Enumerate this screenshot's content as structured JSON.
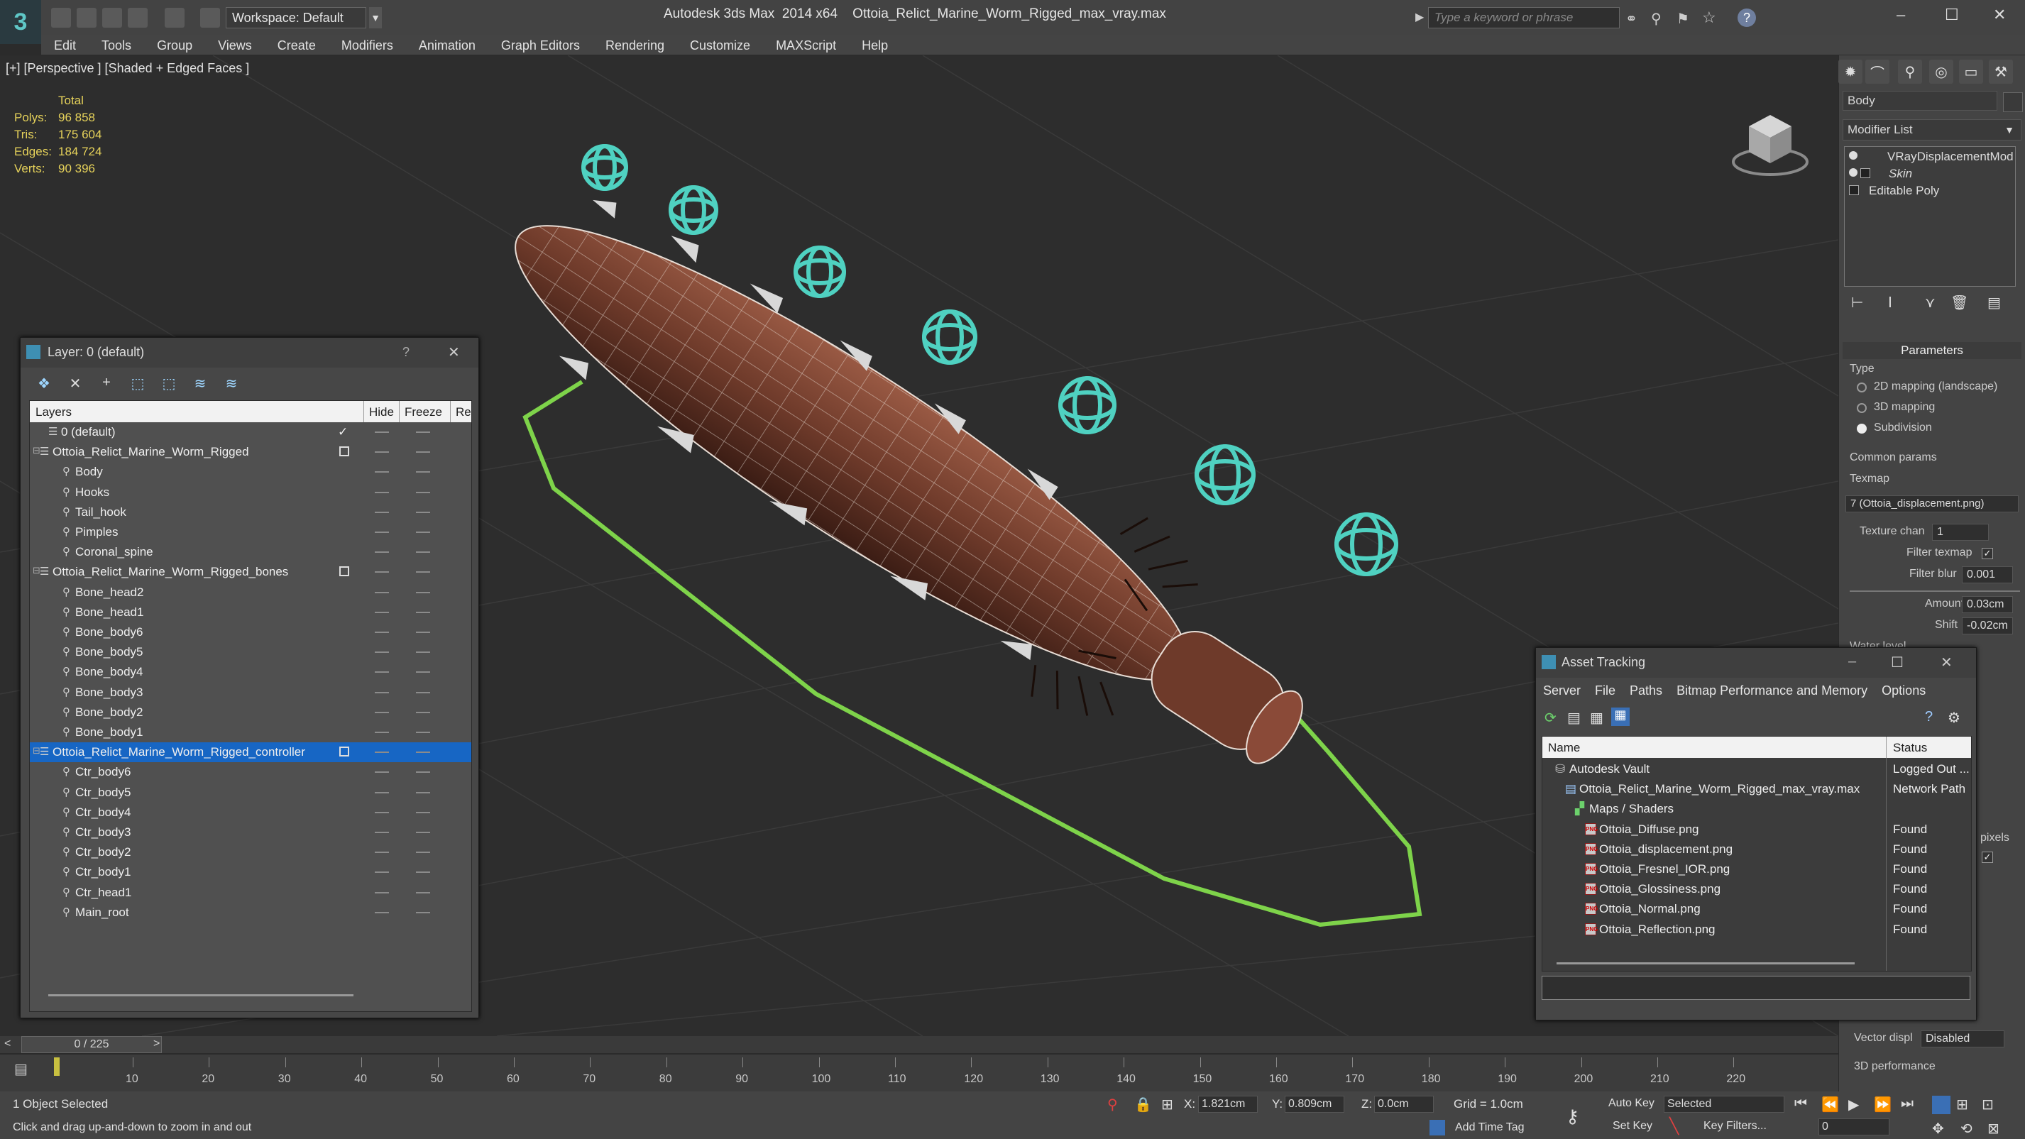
{
  "app": {
    "title": "Autodesk 3ds Max  2014 x64",
    "file": "Ottoia_Relict_Marine_Worm_Rigged_max_vray.max",
    "workspace": "Workspace: Default",
    "search_placeholder": "Type a keyword or phrase"
  },
  "menu": [
    "Edit",
    "Tools",
    "Group",
    "Views",
    "Create",
    "Modifiers",
    "Animation",
    "Graph Editors",
    "Rendering",
    "Customize",
    "MAXScript",
    "Help"
  ],
  "viewport": {
    "label": "[+] [Perspective ] [Shaded + Edged Faces ]",
    "stats_header": "Total",
    "stats": [
      {
        "key": "Polys:",
        "value": "96 858"
      },
      {
        "key": "Tris:",
        "value": "175 604"
      },
      {
        "key": "Edges:",
        "value": "184 724"
      },
      {
        "key": "Verts:",
        "value": "90 396"
      }
    ]
  },
  "command_panel": {
    "object_name": "Body",
    "modifier_list": "Modifier List",
    "stack": [
      "VRayDisplacementMod",
      "Skin",
      "Editable Poly"
    ],
    "params_title": "Parameters",
    "type_label": "Type",
    "type_options": [
      {
        "label": "2D mapping (landscape)",
        "selected": false
      },
      {
        "label": "3D mapping",
        "selected": false
      },
      {
        "label": "Subdivision",
        "selected": true
      }
    ],
    "common_params": "Common params",
    "texmap_label": "Texmap",
    "texmap_value": "7 (Ottoia_displacement.png)",
    "texture_chan_label": "Texture chan",
    "texture_chan_value": "1",
    "filter_texmap_label": "Filter texmap",
    "filter_blur_label": "Filter blur",
    "filter_blur_value": "0.001",
    "amount_label": "Amount",
    "amount_value": "0.03cm",
    "shift_label": "Shift",
    "shift_value": "-0.02cm",
    "water_level_label": "Water level",
    "pixels_label": "pixels",
    "vector_disp_label": "Vector displ",
    "vector_disp_value": "Disabled",
    "perf_label": "3D performance"
  },
  "layer_dialog": {
    "title": "Layer: 0 (default)",
    "help": "?",
    "columns": {
      "layers": "Layers",
      "hide": "Hide",
      "freeze": "Freeze",
      "render": "Re"
    },
    "rows": [
      {
        "name": "0 (default)",
        "indent": 1,
        "type": "layer",
        "current": true
      },
      {
        "name": "Ottoia_Relict_Marine_Worm_Rigged",
        "indent": 0,
        "type": "layer",
        "box": true
      },
      {
        "name": "Body",
        "indent": 2,
        "type": "object"
      },
      {
        "name": "Hooks",
        "indent": 2,
        "type": "object"
      },
      {
        "name": "Tail_hook",
        "indent": 2,
        "type": "object"
      },
      {
        "name": "Pimples",
        "indent": 2,
        "type": "object"
      },
      {
        "name": "Coronal_spine",
        "indent": 2,
        "type": "object"
      },
      {
        "name": "Ottoia_Relict_Marine_Worm_Rigged_bones",
        "indent": 0,
        "type": "layer",
        "box": true
      },
      {
        "name": "Bone_head2",
        "indent": 2,
        "type": "object"
      },
      {
        "name": "Bone_head1",
        "indent": 2,
        "type": "object"
      },
      {
        "name": "Bone_body6",
        "indent": 2,
        "type": "object"
      },
      {
        "name": "Bone_body5",
        "indent": 2,
        "type": "object"
      },
      {
        "name": "Bone_body4",
        "indent": 2,
        "type": "object"
      },
      {
        "name": "Bone_body3",
        "indent": 2,
        "type": "object"
      },
      {
        "name": "Bone_body2",
        "indent": 2,
        "type": "object"
      },
      {
        "name": "Bone_body1",
        "indent": 2,
        "type": "object"
      },
      {
        "name": "Ottoia_Relict_Marine_Worm_Rigged_controller",
        "indent": 0,
        "type": "layer",
        "box": true,
        "selected": true
      },
      {
        "name": "Ctr_body6",
        "indent": 2,
        "type": "object"
      },
      {
        "name": "Ctr_body5",
        "indent": 2,
        "type": "object"
      },
      {
        "name": "Ctr_body4",
        "indent": 2,
        "type": "object"
      },
      {
        "name": "Ctr_body3",
        "indent": 2,
        "type": "object"
      },
      {
        "name": "Ctr_body2",
        "indent": 2,
        "type": "object"
      },
      {
        "name": "Ctr_body1",
        "indent": 2,
        "type": "object"
      },
      {
        "name": "Ctr_head1",
        "indent": 2,
        "type": "object"
      },
      {
        "name": "Main_root",
        "indent": 2,
        "type": "object"
      }
    ]
  },
  "asset_dialog": {
    "title": "Asset Tracking",
    "menu": [
      "Server",
      "File",
      "Paths",
      "Bitmap Performance and Memory",
      "Options"
    ],
    "columns": {
      "name": "Name",
      "status": "Status"
    },
    "rows": [
      {
        "name": "Autodesk Vault",
        "indent": 1,
        "status": "Logged Out ...",
        "icon": "vault"
      },
      {
        "name": "Ottoia_Relict_Marine_Worm_Rigged_max_vray.max",
        "indent": 2,
        "status": "Network Path",
        "icon": "max"
      },
      {
        "name": "Maps / Shaders",
        "indent": 3,
        "status": "",
        "icon": "folder"
      },
      {
        "name": "Ottoia_Diffuse.png",
        "indent": 4,
        "status": "Found",
        "icon": "png"
      },
      {
        "name": "Ottoia_displacement.png",
        "indent": 4,
        "status": "Found",
        "icon": "png"
      },
      {
        "name": "Ottoia_Fresnel_IOR.png",
        "indent": 4,
        "status": "Found",
        "icon": "png"
      },
      {
        "name": "Ottoia_Glossiness.png",
        "indent": 4,
        "status": "Found",
        "icon": "png"
      },
      {
        "name": "Ottoia_Normal.png",
        "indent": 4,
        "status": "Found",
        "icon": "png"
      },
      {
        "name": "Ottoia_Reflection.png",
        "indent": 4,
        "status": "Found",
        "icon": "png"
      }
    ]
  },
  "timeline": {
    "frame": "0 / 225",
    "ticks": [
      "10",
      "20",
      "30",
      "40",
      "50",
      "60",
      "70",
      "80",
      "90",
      "100",
      "110",
      "120",
      "130",
      "140",
      "150",
      "160",
      "170",
      "180",
      "190",
      "200",
      "210",
      "220"
    ]
  },
  "status": {
    "selection": "1 Object Selected",
    "prompt": "Click and drag up-and-down to zoom in and out",
    "x_label": "X:",
    "x_value": "1.821cm",
    "y_label": "Y:",
    "y_value": "0.809cm",
    "z_label": "Z:",
    "z_value": "0.0cm",
    "grid": "Grid = 1.0cm",
    "add_time_tag": "Add Time Tag",
    "auto_key": "Auto Key",
    "set_key": "Set Key",
    "selected": "Selected",
    "key_filters": "Key Filters...",
    "current_frame": "0"
  },
  "colors": {
    "selection_blue": "#1766c4",
    "stats_yellow": "#e6d25a",
    "controller_cyan": "#4fd1c1",
    "spline_green": "#7ed34a",
    "worm_brown": "#6e3a2a"
  }
}
